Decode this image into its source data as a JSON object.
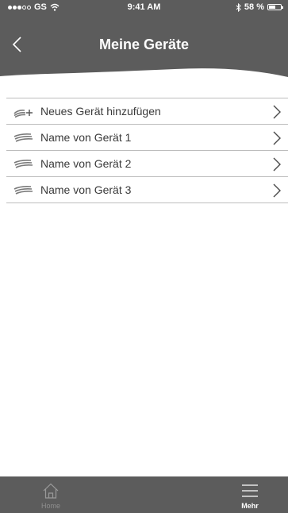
{
  "status_bar": {
    "carrier": "GS",
    "time": "9:41 AM",
    "battery": "58 %",
    "battery_level": 0.58,
    "signal_bars_filled": 3,
    "signal_bars_total": 5
  },
  "header": {
    "title": "Meine Geräte",
    "back_icon": "chevron-left-icon"
  },
  "devices": {
    "add_label": "Neues Gerät hinzufügen",
    "items": [
      {
        "label": "Name von Gerät 1"
      },
      {
        "label": "Name von Gerät 2"
      },
      {
        "label": "Name von Gerät 3"
      }
    ]
  },
  "tab_bar": {
    "home_label": "Home",
    "more_label": "Mehr",
    "active_tab": "more"
  },
  "colors": {
    "bar_gray": "#5c5c5c",
    "divider": "#bdbdbd",
    "text": "#3a3a3a"
  }
}
